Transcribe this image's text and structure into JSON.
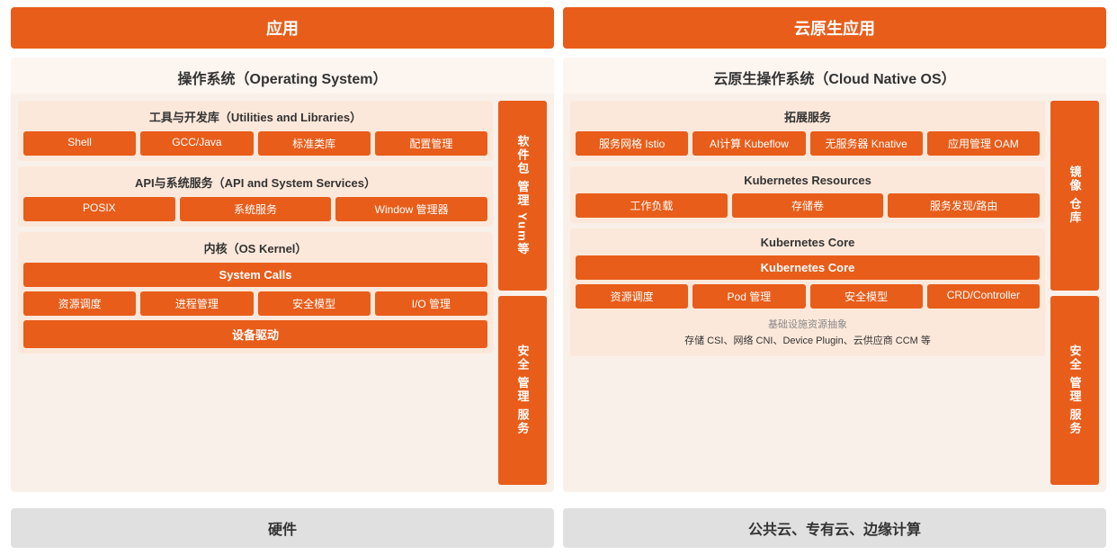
{
  "top": {
    "left_label": "应用",
    "right_label": "云原生应用"
  },
  "bottom": {
    "left_label": "硬件",
    "right_label": "公共云、专有云、边缘计算"
  },
  "left_panel": {
    "title": "操作系统（Operating System）",
    "sidebar": {
      "top_block": "软件包\n管理\nYum等",
      "bottom_block": "安全\n管理\n服务"
    },
    "section1": {
      "title": "工具与开发库（Utilities and Libraries）",
      "items": [
        "Shell",
        "GCC/Java",
        "标准类库",
        "配置管理"
      ]
    },
    "section2": {
      "title": "API与系统服务（API and System Services）",
      "items": [
        "POSIX",
        "系统服务",
        "Window 管理器"
      ]
    },
    "section3": {
      "title": "内核（OS Kernel）",
      "system_calls": "System Calls",
      "items": [
        "资源调度",
        "进程管理",
        "安全模型",
        "I/O 管理"
      ],
      "device": "设备驱动"
    }
  },
  "right_panel": {
    "title": "云原生操作系统（Cloud Native OS）",
    "sidebar": {
      "top_block": "镜像\n仓库",
      "bottom_block": "安全\n管理\n服务"
    },
    "section1": {
      "title": "拓展服务",
      "items": [
        "服务网格 Istio",
        "AI计算 Kubeflow",
        "无服务器 Knative",
        "应用管理 OAM"
      ]
    },
    "section2": {
      "title": "Kubernetes Resources",
      "items": [
        "工作负载",
        "存储卷",
        "服务发现/路由"
      ]
    },
    "section3": {
      "title": "Kubernetes Core",
      "core_bar": "Kubernetes Core",
      "items": [
        "资源调度",
        "Pod 管理",
        "安全模型",
        "CRD/Controller"
      ],
      "infra_title": "基础设施资源抽象",
      "infra_detail": "存储 CSI、网络 CNI、Device Plugin、云供应商 CCM 等"
    }
  }
}
